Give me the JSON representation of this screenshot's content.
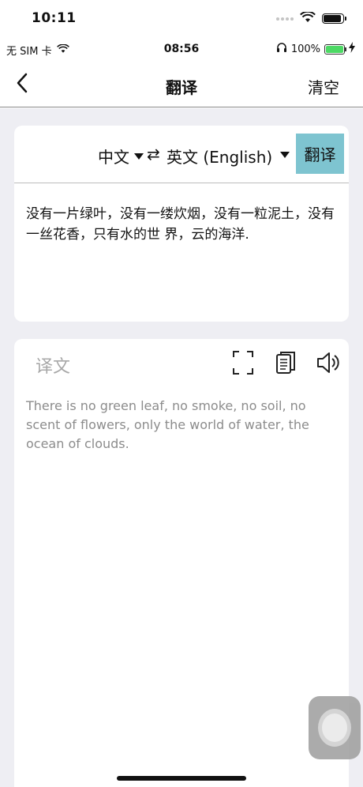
{
  "device_status": {
    "time": "10:11"
  },
  "app_status": {
    "carrier": "无 SIM 卡",
    "time": "08:56",
    "battery": "100%"
  },
  "nav": {
    "title": "翻译",
    "clear_label": "清空"
  },
  "language": {
    "source": "中文",
    "swap": "⇄",
    "target": "英文 (English)",
    "translate_label": "翻译"
  },
  "input": {
    "text": "没有一片绿叶，没有一缕炊烟，没有一粒泥土，没有一丝花香，只有水的世 界，云的海洋."
  },
  "output": {
    "label": "译文",
    "text": "There is no green leaf, no smoke, no soil, no scent of flowers, only the world of water, the ocean of clouds."
  },
  "colors": {
    "accent": "#7ec4d0",
    "background": "#eeeef3",
    "battery_green": "#4cd964"
  },
  "icons": [
    "back-chevron-icon",
    "dropdown-arrow-icon",
    "swap-icon",
    "fullscreen-icon",
    "copy-icon",
    "speaker-icon",
    "wifi-icon",
    "headphones-icon",
    "charging-icon"
  ]
}
